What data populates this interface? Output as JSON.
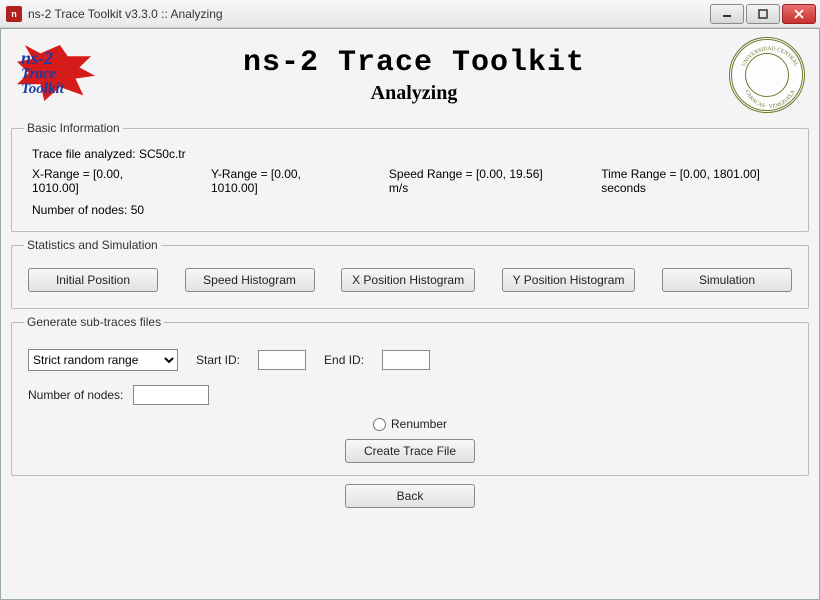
{
  "window": {
    "title": "ns-2 Trace Toolkit v3.3.0 :: Analyzing"
  },
  "header": {
    "logo_l1": "ns-2",
    "logo_l2": "Trace",
    "logo_l3": "Toolkit",
    "title_main": "ns-2 Trace Toolkit",
    "title_sub": "Analyzing",
    "seal_top": "UNIVERSIDAD CENTRAL",
    "seal_bot": "CARACAS · VENEZUELA"
  },
  "basic": {
    "legend": "Basic Information",
    "trace_file_label": "Trace file analyzed:",
    "trace_file_value": "SC50c.tr",
    "x_range": "X-Range = [0.00, 1010.00]",
    "y_range": "Y-Range = [0.00, 1010.00]",
    "speed_range": "Speed Range = [0.00, 19.56] m/s",
    "time_range": "Time Range = [0.00, 1801.00] seconds",
    "nodes_label": "Number of nodes:",
    "nodes_value": "50"
  },
  "stats": {
    "legend": "Statistics and Simulation",
    "btn_initial": "Initial Position",
    "btn_speed": "Speed Histogram",
    "btn_xpos": "X Position Histogram",
    "btn_ypos": "Y Position Histogram",
    "btn_sim": "Simulation"
  },
  "gen": {
    "legend": "Generate sub-traces files",
    "mode_selected": "Strict random range",
    "start_label": "Start ID:",
    "start_value": "",
    "end_label": "End ID:",
    "end_value": "",
    "nodes_label": "Number of nodes:",
    "nodes_value": "",
    "renumber_label": "Renumber",
    "create_btn": "Create Trace File"
  },
  "footer": {
    "back_btn": "Back"
  }
}
